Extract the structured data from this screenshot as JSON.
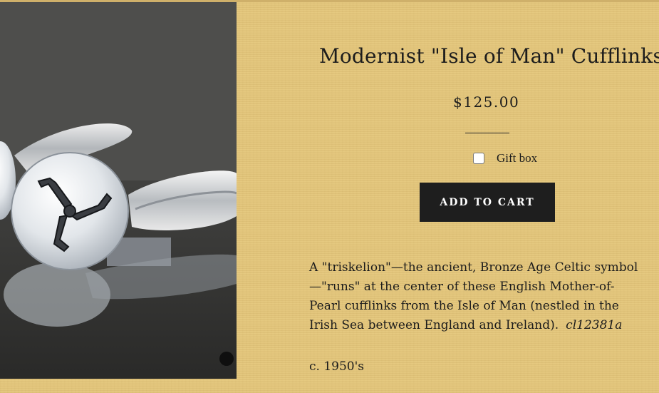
{
  "product": {
    "title": "Modernist \"Isle of Man\" Cufflinks",
    "price": "$125.00",
    "image_alt": "",
    "gift_box_label": "Gift box",
    "gift_box_checked": false,
    "add_to_cart_label": "ADD TO CART",
    "description": "A \"triskelion\"—the ancient, Bronze Age Celtic symbol—\"runs\" at the center of these English Mother-of-Pearl cufflinks from the Isle of Man (nestled in the Irish Sea between England and Ireland).",
    "sku": "cl12381a",
    "era": "c. 1950's"
  },
  "colors": {
    "background": "#e5c87e",
    "button": "#1e1e1e",
    "button_text": "#ffffff",
    "text": "#1c1c1c"
  }
}
